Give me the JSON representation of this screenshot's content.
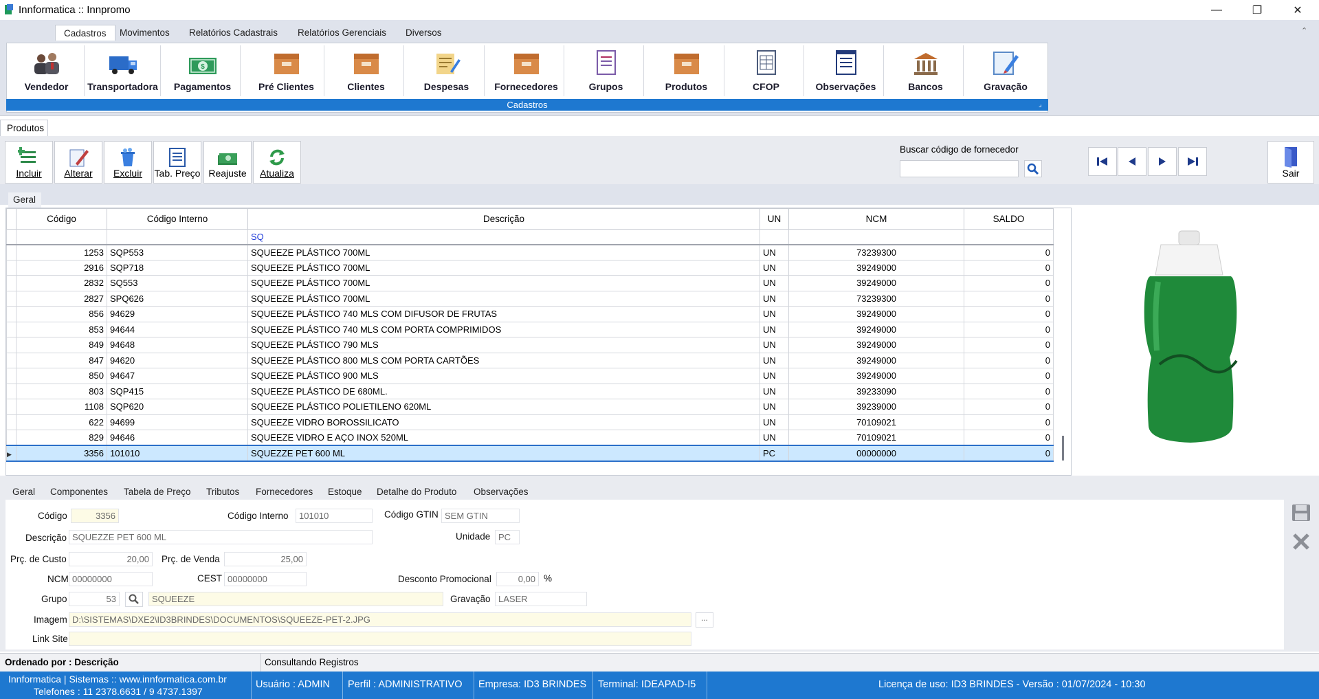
{
  "window": {
    "title": "Innformatica :: Innpromo",
    "minimize": "—",
    "maximize": "❐",
    "close": "✕"
  },
  "ribbon": {
    "tabs": [
      "Cadastros",
      "Movimentos",
      "Relatórios Cadastrais",
      "Relatórios Gerenciais",
      "Diversos"
    ],
    "buttons": [
      "Vendedor",
      "Transportadora",
      "Pagamentos",
      "Pré Clientes",
      "Clientes",
      "Despesas",
      "Fornecedores",
      "Grupos",
      "Produtos",
      "CFOP",
      "Observações",
      "Bancos",
      "Gravação"
    ],
    "group_label": "Cadastros"
  },
  "form_tab": "Produtos",
  "toolbar": {
    "buttons": [
      "Incluir",
      "Alterar",
      "Excluir",
      "Tab. Preço",
      "Reajuste",
      "Atualiza"
    ],
    "search_label": "Buscar código de fornecedor",
    "search_value": "",
    "exit": "Sair"
  },
  "grid": {
    "tab": "Geral",
    "columns": [
      "Código",
      "Código Interno",
      "Descrição",
      "UN",
      "NCM",
      "SALDO"
    ],
    "filter": {
      "descricao": "SQ"
    },
    "rows": [
      [
        "1253",
        "SQP553",
        "SQUEEZE PLÁSTICO 700ML",
        "UN",
        "73239300",
        "0"
      ],
      [
        "2916",
        "SQP718",
        "SQUEEZE PLÁSTICO 700ML",
        "UN",
        "39249000",
        "0"
      ],
      [
        "2832",
        "SQ553",
        "SQUEEZE PLÁSTICO 700ML",
        "UN",
        "39249000",
        "0"
      ],
      [
        "2827",
        "SPQ626",
        "SQUEEZE PLÁSTICO 700ML",
        "UN",
        "73239300",
        "0"
      ],
      [
        "856",
        "94629",
        "SQUEEZE PLÁSTICO 740 MLS COM DIFUSOR DE FRUTAS",
        "UN",
        "39249000",
        "0"
      ],
      [
        "853",
        "94644",
        "SQUEEZE PLÁSTICO 740 MLS COM PORTA COMPRIMIDOS",
        "UN",
        "39249000",
        "0"
      ],
      [
        "849",
        "94648",
        "SQUEEZE PLÁSTICO 790 MLS",
        "UN",
        "39249000",
        "0"
      ],
      [
        "847",
        "94620",
        "SQUEEZE PLÁSTICO 800 MLS COM PORTA CARTÕES",
        "UN",
        "39249000",
        "0"
      ],
      [
        "850",
        "94647",
        "SQUEEZE PLÁSTICO 900 MLS",
        "UN",
        "39249000",
        "0"
      ],
      [
        "803",
        "SQP415",
        "SQUEEZE PLÁSTICO DE 680ML.",
        "UN",
        "39233090",
        "0"
      ],
      [
        "1108",
        "SQP620",
        "SQUEEZE PLÁSTICO POLIETILENO 620ML",
        "UN",
        "39239000",
        "0"
      ],
      [
        "622",
        "94699",
        "SQUEEZE VIDRO BOROSSILICATO",
        "UN",
        "70109021",
        "0"
      ],
      [
        "829",
        "94646",
        "SQUEEZE VIDRO E AÇO INOX 520ML",
        "UN",
        "70109021",
        "0"
      ],
      [
        "3356",
        "101010",
        "SQUEZZE PET 600 ML",
        "PC",
        "00000000",
        "0"
      ]
    ]
  },
  "detail": {
    "tabs": [
      "Geral",
      "Componentes",
      "Tabela de Preço",
      "Tributos",
      "Fornecedores",
      "Estoque",
      "Detalhe do Produto",
      "Observações"
    ],
    "labels": {
      "codigo": "Código",
      "codigo_interno": "Código Interno",
      "gtin": "Código GTIN",
      "descricao": "Descrição",
      "unidade": "Unidade",
      "custo": "Prç. de Custo",
      "venda": "Prç. de Venda",
      "ncm": "NCM",
      "cest": "CEST",
      "desconto": "Desconto Promocional",
      "grupo": "Grupo",
      "gravacao": "Gravação",
      "imagem": "Imagem",
      "link": "Link Site",
      "percent": "%"
    },
    "values": {
      "codigo": "3356",
      "codigo_interno": "101010",
      "gtin": "SEM GTIN",
      "descricao": "SQUEZZE PET 600 ML",
      "unidade": "PC",
      "custo": "20,00",
      "venda": "25,00",
      "ncm": "00000000",
      "cest": "00000000",
      "desconto": "0,00",
      "grupo_cod": "53",
      "grupo_nome": "SQUEEZE",
      "gravacao": "LASER",
      "imagem": "D:\\SISTEMAS\\DXE2\\ID3BRINDES\\DOCUMENTOS\\SQUEEZE-PET-2.JPG",
      "link": "",
      "ellipsis": "..."
    }
  },
  "status": {
    "ordered": "Ordenado por : Descrição",
    "state": "Consultando Registros",
    "company_line1": "Innformatica | Sistemas :: www.innformatica.com.br",
    "company_line2": "Telefones : 11 2378.6631 / 9 4737.1397",
    "user": "Usuário : ADMIN",
    "profile": "Perfil : ADMINISTRATIVO",
    "empresa": "Empresa: ID3 BRINDES",
    "terminal": "Terminal: IDEAPAD-I5",
    "license": "Licença de uso: ID3 BRINDES - Versão : 01/07/2024 - 10:30"
  }
}
